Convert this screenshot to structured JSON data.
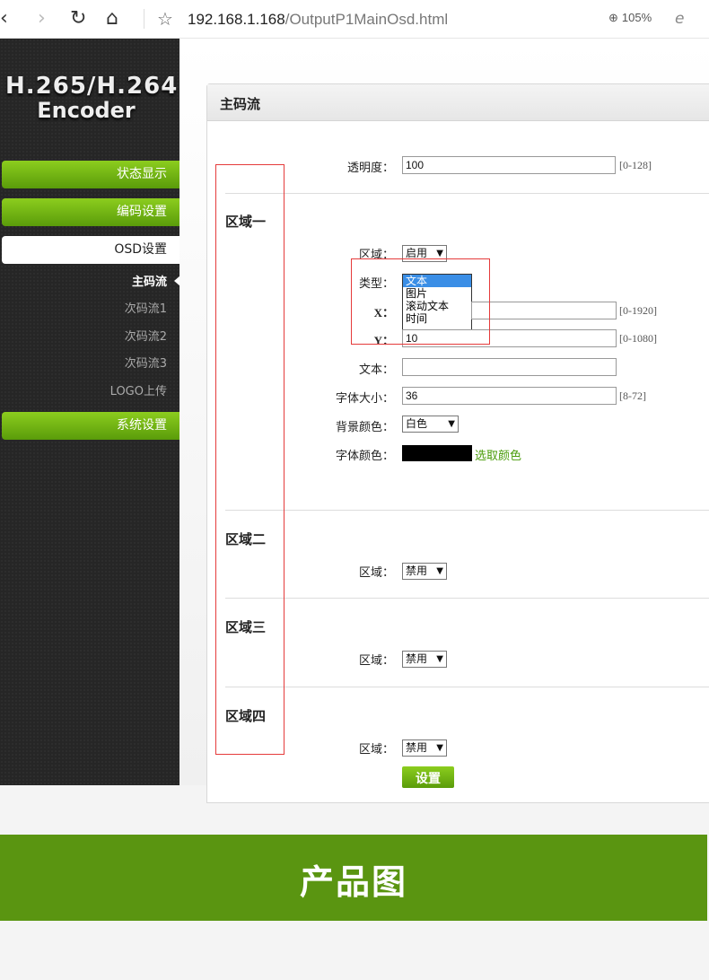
{
  "browser": {
    "url_host": "192.168.1.168",
    "url_path": "/OutputP1MainOsd.html",
    "zoom": "105%",
    "icons": [
      "back-icon",
      "forward-icon",
      "reload-icon",
      "home-icon",
      "star-icon",
      "zoom-icon",
      "ie-icon"
    ]
  },
  "sidebar": {
    "brand_line1": "H.265/H.264",
    "brand_line2": "Encoder",
    "menu": [
      {
        "label": "状态显示"
      },
      {
        "label": "编码设置"
      },
      {
        "label": "OSD设置"
      },
      {
        "label": "系统设置"
      }
    ],
    "submenu": [
      {
        "label": "主码流"
      },
      {
        "label": "次码流1"
      },
      {
        "label": "次码流2"
      },
      {
        "label": "次码流3"
      },
      {
        "label": "LOGO上传"
      }
    ]
  },
  "panel": {
    "title": "主码流",
    "transparency": {
      "label": "透明度：",
      "value": "100",
      "range": "[0-128]"
    },
    "region1": {
      "title": "区域一",
      "area_label": "区域：",
      "area_value": "启用",
      "type_label": "类型：",
      "type_value": "文本",
      "type_options": [
        "文本",
        "图片",
        "滚动文本",
        "时间"
      ],
      "x_label": "X：",
      "x_value": "",
      "x_range": "[0-1920]",
      "y_label": "Y：",
      "y_value": "10",
      "y_range": "[0-1080]",
      "text_label": "文本：",
      "text_value": "",
      "fontsize_label": "字体大小：",
      "fontsize_value": "36",
      "fontsize_range": "[8-72]",
      "bg_label": "背景颜色：",
      "bg_value": "白色",
      "fontcolor_label": "字体颜色：",
      "fontcolor_value": "#000000",
      "pick_color": "选取颜色"
    },
    "region2": {
      "title": "区域二",
      "area_label": "区域：",
      "area_value": "禁用"
    },
    "region3": {
      "title": "区域三",
      "area_label": "区域：",
      "area_value": "禁用"
    },
    "region4": {
      "title": "区域四",
      "area_label": "区域：",
      "area_value": "禁用"
    },
    "submit": "设置"
  },
  "banner": {
    "title": "产品图"
  },
  "colors": {
    "green": "#5a9511",
    "accent": "#8ccd1e",
    "annotation_red": "#e53b3b"
  }
}
